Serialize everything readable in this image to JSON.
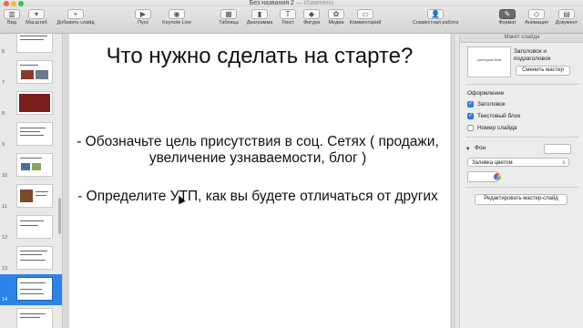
{
  "window": {
    "title": "Без названия 2",
    "subtitle": "— Изменено",
    "traffic_colors": [
      "#ff5f57",
      "#febc2e",
      "#28c840"
    ]
  },
  "toolbar": {
    "left": [
      {
        "name": "view",
        "label": "Вид",
        "icon": "sidebar-icon"
      },
      {
        "name": "zoom",
        "label": "Масштаб",
        "icon": "zoom-icon"
      },
      {
        "name": "add-slide",
        "label": "Добавить слайд",
        "icon": "plus-icon"
      }
    ],
    "play": {
      "label": "Пуск",
      "icon": "play-icon"
    },
    "keynote_live": {
      "label": "Keynote Live",
      "icon": "broadcast-icon"
    },
    "insert": [
      {
        "name": "table",
        "label": "Таблица",
        "icon": "table-icon"
      },
      {
        "name": "chart",
        "label": "Диаграмма",
        "icon": "chart-icon"
      },
      {
        "name": "text",
        "label": "Текст",
        "icon": "text-icon"
      },
      {
        "name": "shape",
        "label": "Фигура",
        "icon": "shape-icon"
      },
      {
        "name": "media",
        "label": "Медиа",
        "icon": "media-icon"
      },
      {
        "name": "comment",
        "label": "Комментарий",
        "icon": "comment-icon"
      }
    ],
    "collaborate": {
      "label": "Совместная работа",
      "icon": "collaborate-icon"
    },
    "inspector_tabs": [
      {
        "name": "format",
        "label": "Формат",
        "icon": "brush-icon",
        "active": true
      },
      {
        "name": "animate",
        "label": "Анимация",
        "icon": "animate-icon",
        "active": false
      },
      {
        "name": "document",
        "label": "Документ",
        "icon": "document-icon",
        "active": false
      }
    ]
  },
  "navigator": {
    "slides": [
      {
        "num": "6"
      },
      {
        "num": "7"
      },
      {
        "num": "8"
      },
      {
        "num": "9"
      },
      {
        "num": "10"
      },
      {
        "num": "11"
      },
      {
        "num": "12"
      },
      {
        "num": "13"
      },
      {
        "num": "14",
        "selected": true
      },
      {
        "num": "15"
      }
    ],
    "selected_color": "#2d83e6"
  },
  "slide": {
    "title": "Что нужно сделать на старте?",
    "bullet1": "- Обозначьте цель присутствия в соц. Сетях ( продажи, увеличение узнаваемости, блог )",
    "bullet2": "- Определите УТП, как вы будете отличаться от других"
  },
  "inspector": {
    "tab_title": "Макет слайда",
    "master_preview_text": "Lorem Ipsum Dolor",
    "master_name": "Заголовок и подзаголовок",
    "change_master_label": "Сменить мастер",
    "appearance_label": "Оформление",
    "checkboxes": [
      {
        "name": "title",
        "label": "Заголовок",
        "checked": true
      },
      {
        "name": "body",
        "label": "Текстовый блок",
        "checked": true
      },
      {
        "name": "slide-number",
        "label": "Номер слайда",
        "checked": false
      }
    ],
    "background_label": "Фон",
    "fill_value": "Заливка цветом",
    "edit_master_label": "Редактировать мастер-слайд"
  }
}
